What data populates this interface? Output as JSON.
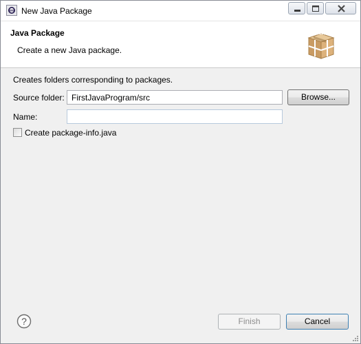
{
  "window": {
    "title": "New Java Package",
    "app_icon": "eclipse-icon",
    "controls": [
      "minimize-icon",
      "maximize-icon",
      "close-icon"
    ]
  },
  "banner": {
    "title": "Java Package",
    "description": "Create a new Java package.",
    "icon": "package-icon"
  },
  "form": {
    "intro": "Creates folders corresponding to packages.",
    "source_folder_label": "Source folder:",
    "source_folder_value": "FirstJavaProgram/src",
    "browse_label": "Browse...",
    "name_label": "Name:",
    "name_value": "",
    "create_package_info_label": "Create package-info.java",
    "create_package_info_checked": false
  },
  "footer": {
    "help_icon": "help-icon",
    "finish_label": "Finish",
    "finish_enabled": false,
    "cancel_label": "Cancel"
  }
}
